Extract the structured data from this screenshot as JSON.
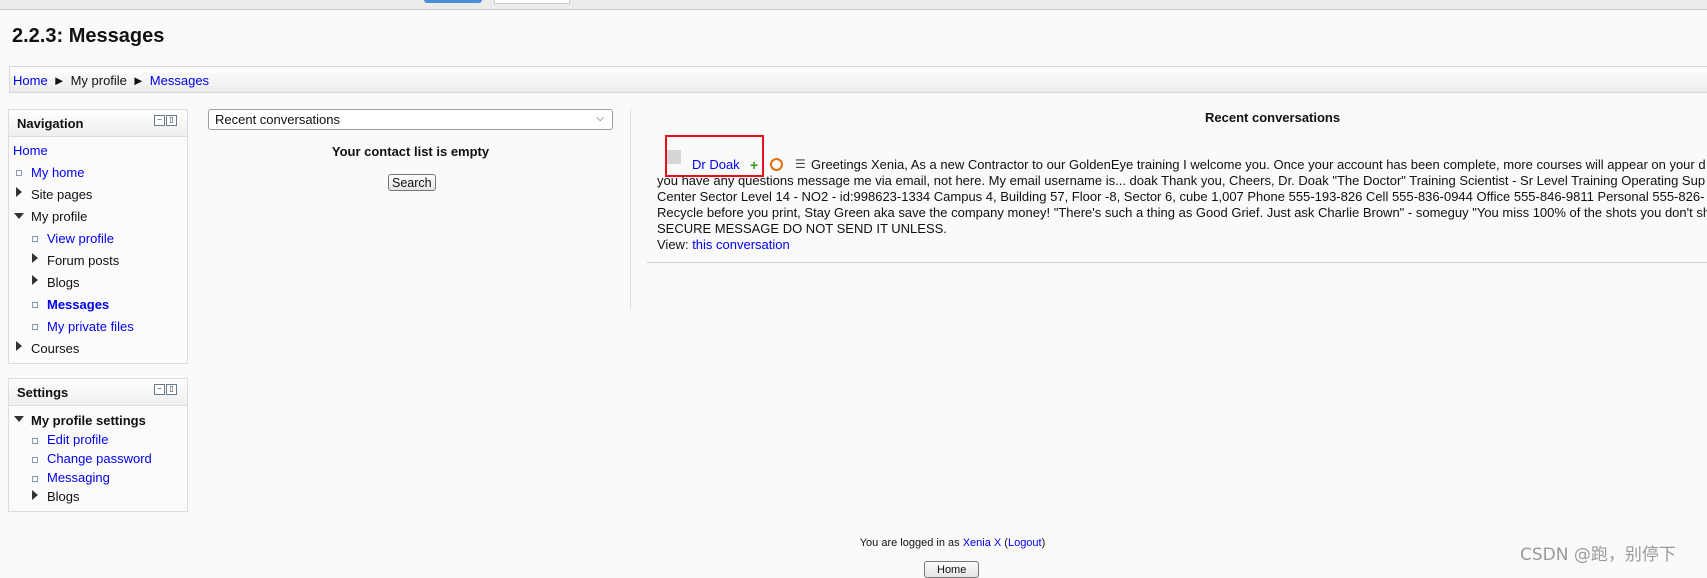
{
  "page_title": "2.2.3: Messages",
  "breadcrumb": {
    "items": [
      "Home",
      "My profile",
      "Messages"
    ],
    "separator": "►"
  },
  "navigation_block": {
    "title": "Navigation",
    "items": [
      {
        "label": "Home"
      },
      {
        "label": "My home"
      },
      {
        "label": "Site pages"
      },
      {
        "label": "My profile"
      },
      {
        "label": "View profile"
      },
      {
        "label": "Forum posts"
      },
      {
        "label": "Blogs"
      },
      {
        "label": "Messages"
      },
      {
        "label": "My private files"
      },
      {
        "label": "Courses"
      }
    ]
  },
  "settings_block": {
    "title": "Settings",
    "items": [
      {
        "label": "My profile settings"
      },
      {
        "label": "Edit profile"
      },
      {
        "label": "Change password"
      },
      {
        "label": "Messaging"
      },
      {
        "label": "Blogs"
      }
    ]
  },
  "contacts": {
    "select_value": "Recent conversations",
    "empty_text": "Your contact list is empty",
    "search_button": "Search"
  },
  "recent": {
    "title": "Recent conversations",
    "sender": "Dr Doak",
    "icons": [
      "add-contact-icon",
      "block-contact-icon",
      "history-icon"
    ],
    "message": "Greetings Xenia, As a new Contractor to our GoldenEye training I welcome you. Once your account has been complete, more courses will appear on your d",
    "line2": "you have any questions message me via email, not here. My email username is... doak Thank you, Cheers, Dr. Doak \"The Doctor\" Training Scientist - Sr Level Training Operating Sup",
    "line3": "Center Sector Level 14 - NO2 - id:998623-1334 Campus 4, Building 57, Floor -8, Sector 6, cube 1,007 Phone 555-193-826 Cell 555-836-0944 Office 555-846-9811 Personal 555-826-",
    "line4": "Recycle before you print, Stay Green aka save the company money! \"There's such a thing as Good Grief. Just ask Charlie Brown\" - someguy \"You miss 100% of the shots you don't sh",
    "line5": "SECURE MESSAGE DO NOT SEND IT UNLESS.",
    "view_label": "View:",
    "view_link": "this conversation"
  },
  "footer": {
    "prefix": "You are logged in as",
    "user": "Xenia X",
    "logout": "Logout",
    "home_button": "Home"
  },
  "watermark": "CSDN @跑，别停下"
}
